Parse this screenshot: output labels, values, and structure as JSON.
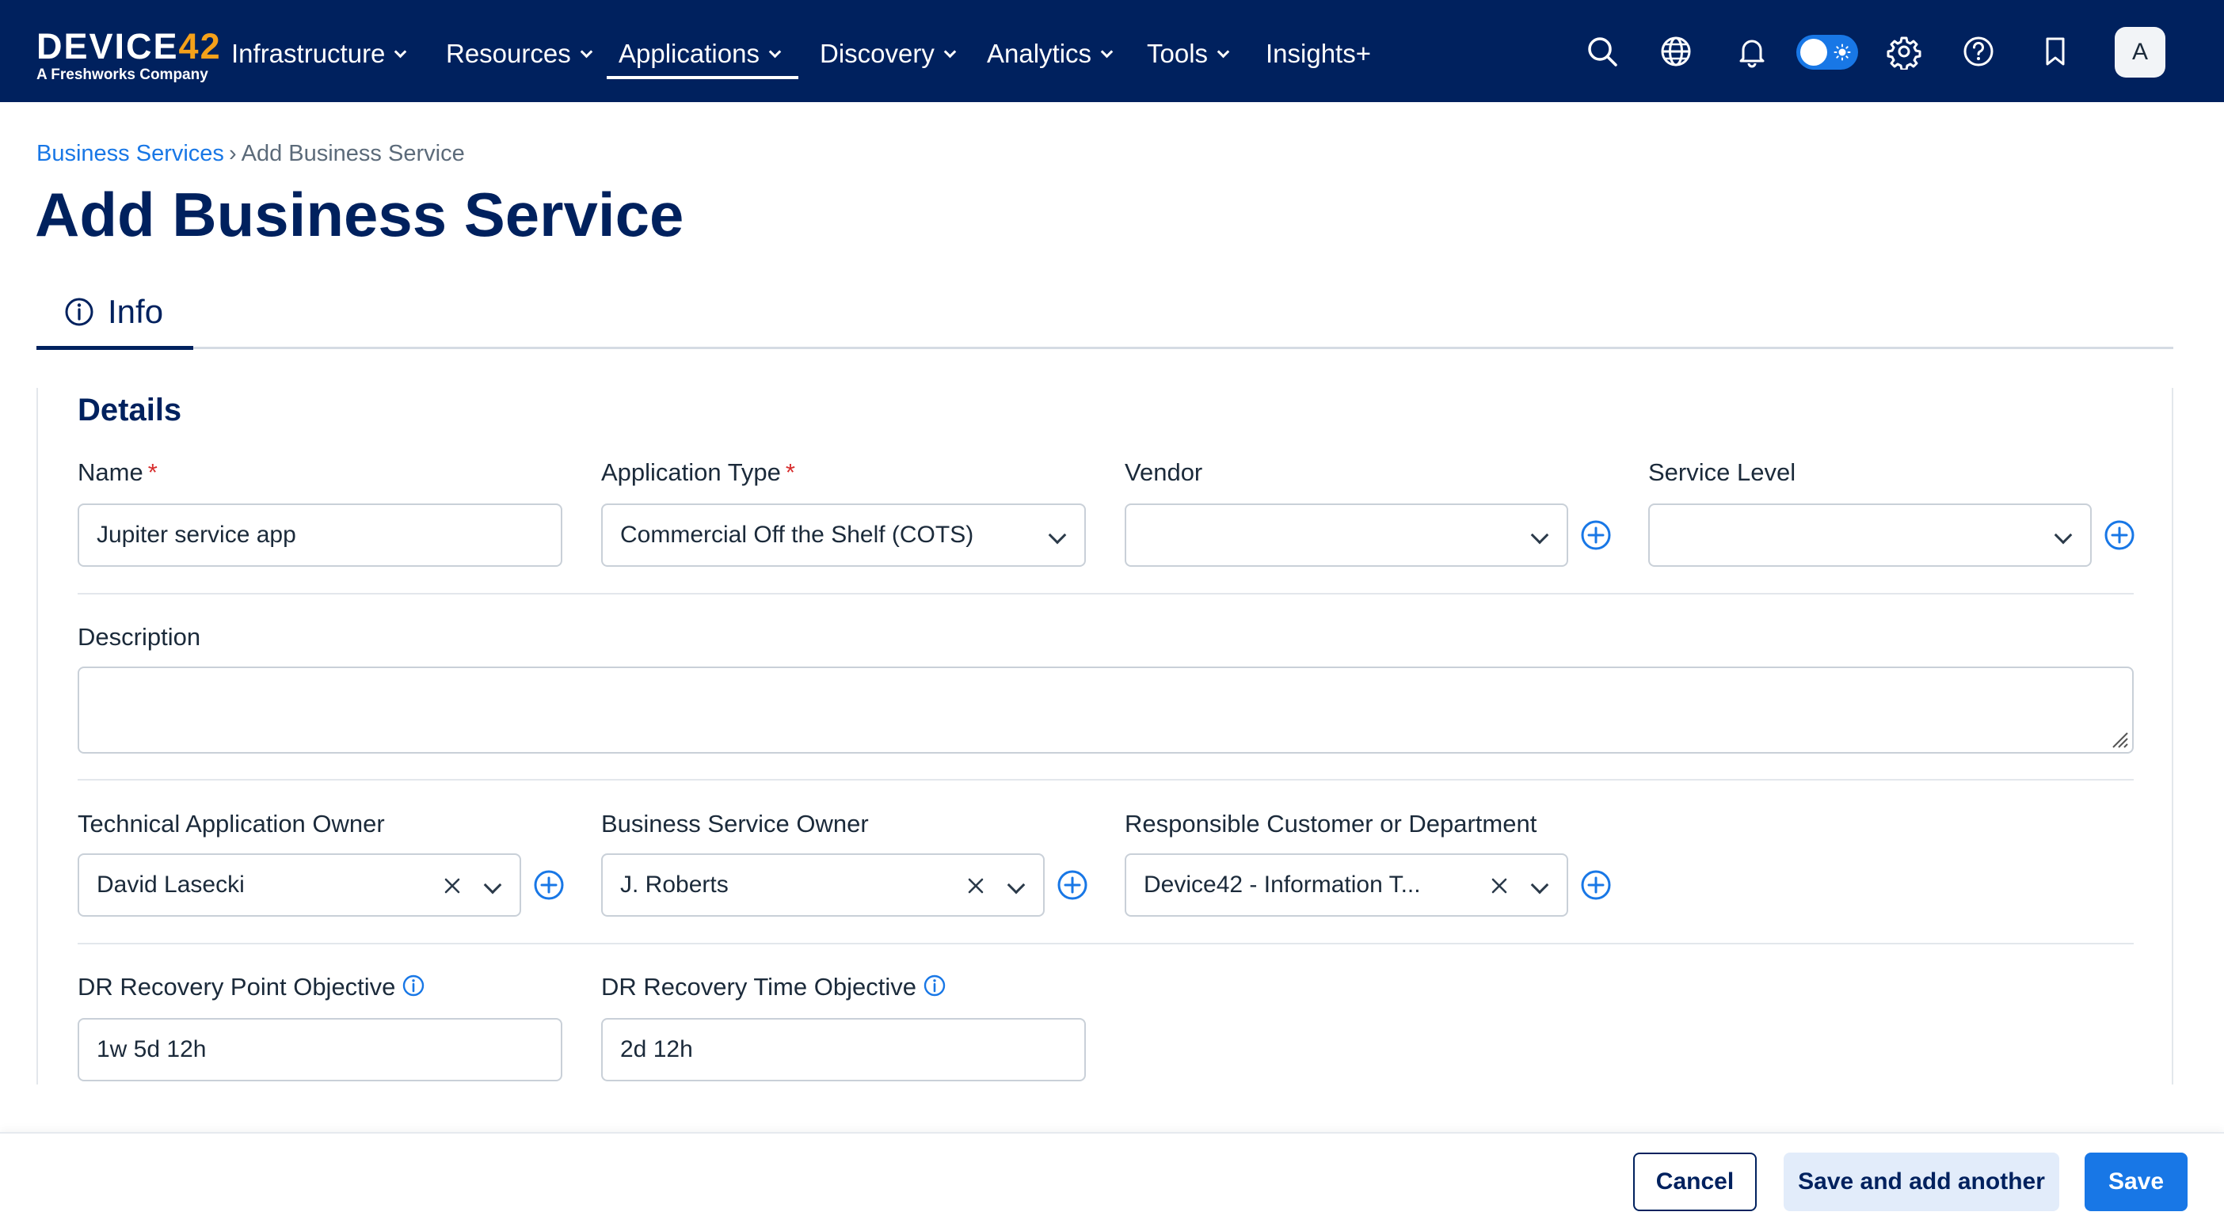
{
  "brand": {
    "logo_main": "DEVICE",
    "logo_num": "42",
    "tagline": "A Freshworks Company"
  },
  "nav": {
    "items": [
      {
        "label": "Infrastructure",
        "has_menu": true
      },
      {
        "label": "Resources",
        "has_menu": true
      },
      {
        "label": "Applications",
        "has_menu": true,
        "active": true
      },
      {
        "label": "Discovery",
        "has_menu": true
      },
      {
        "label": "Analytics",
        "has_menu": true
      },
      {
        "label": "Tools",
        "has_menu": true
      },
      {
        "label": "Insights+",
        "has_menu": false
      }
    ],
    "icons": [
      "search-icon",
      "globe-icon",
      "bell-icon",
      "theme-toggle",
      "gear-icon",
      "help-icon",
      "bookmark-icon"
    ],
    "avatar_initial": "A"
  },
  "breadcrumb": {
    "parent": "Business Services",
    "separator": "›",
    "current": "Add Business Service"
  },
  "page_title": "Add Business Service",
  "tabs": [
    {
      "label": "Info",
      "icon": "info-icon",
      "active": true
    }
  ],
  "form": {
    "section_title": "Details",
    "name": {
      "label": "Name",
      "required": true,
      "value": "Jupiter service app"
    },
    "application_type": {
      "label": "Application Type",
      "required": true,
      "value": "Commercial Off the Shelf (COTS)"
    },
    "vendor": {
      "label": "Vendor",
      "value": ""
    },
    "service_level": {
      "label": "Service Level",
      "value": ""
    },
    "description": {
      "label": "Description",
      "value": ""
    },
    "technical_owner": {
      "label": "Technical Application Owner",
      "value": "David Lasecki"
    },
    "business_owner": {
      "label": "Business Service Owner",
      "value": "J. Roberts"
    },
    "responsible_customer": {
      "label": "Responsible Customer or Department",
      "value": "Device42 - Information T..."
    },
    "dr_rpo": {
      "label": "DR Recovery Point Objective",
      "value": "1w 5d 12h"
    },
    "dr_rto": {
      "label": "DR Recovery Time Objective",
      "value": "2d 12h"
    },
    "required_marker": "*"
  },
  "footer": {
    "cancel": "Cancel",
    "save_another": "Save and add another",
    "save": "Save"
  },
  "colors": {
    "navbar": "#00215e",
    "accent": "#1877e6",
    "title": "#00215e",
    "required": "#d72d2d",
    "logo_accent": "#f5a11a"
  }
}
